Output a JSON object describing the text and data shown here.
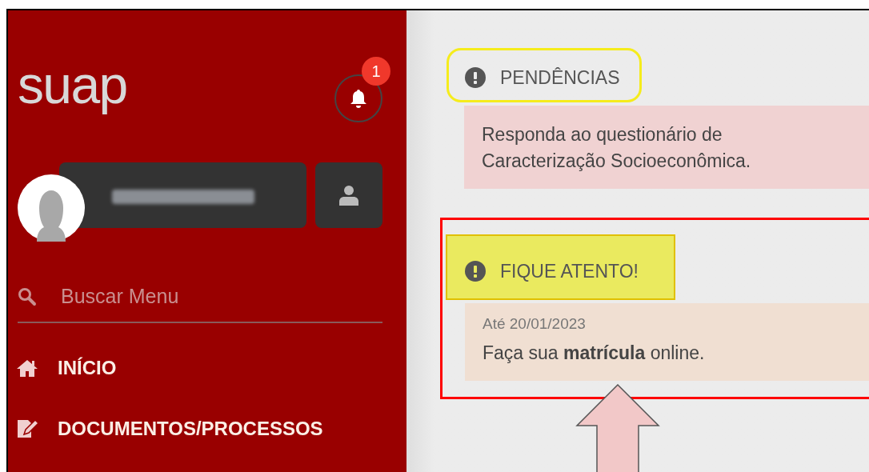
{
  "sidebar": {
    "logo": "suap",
    "notifications": {
      "count": "1"
    },
    "search": {
      "placeholder": "Buscar Menu"
    },
    "menu": [
      {
        "label": "INÍCIO"
      },
      {
        "label": "DOCUMENTOS/PROCESSOS"
      }
    ]
  },
  "alerts": [
    {
      "kind": "pending",
      "title": "PENDÊNCIAS",
      "lines": [
        "Responda ao questionário de Caracterização Socioeconômica."
      ]
    },
    {
      "kind": "attention",
      "title": "FIQUE ATENTO!",
      "date": "Até 20/01/2023",
      "lines": [
        "Faça sua **matrícula** online."
      ]
    }
  ]
}
